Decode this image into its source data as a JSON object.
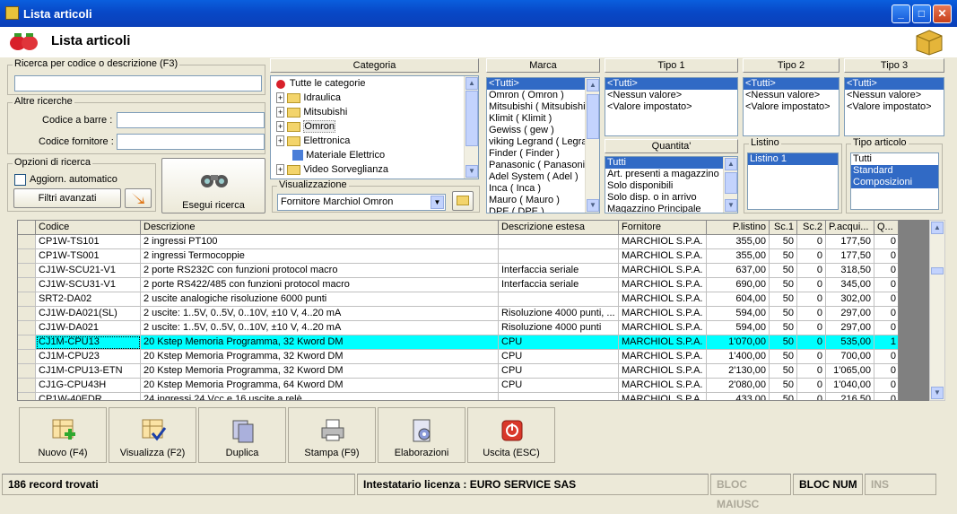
{
  "window": {
    "title": "Lista articoli"
  },
  "header": {
    "title": "Lista articoli"
  },
  "search": {
    "label": "Ricerca per codice o descrizione (F3)",
    "value": ""
  },
  "other": {
    "label": "Altre ricerche",
    "barcode_label": "Codice a barre :",
    "supplier_code_label": "Codice fornitore :"
  },
  "options": {
    "label": "Opzioni di ricerca",
    "auto_update": "Aggiorn. automatico",
    "advanced_filters": "Filtri avanzati",
    "run_search": "Esegui ricerca"
  },
  "category": {
    "header": "Categoria",
    "items": [
      "Tutte le categorie",
      "Idraulica",
      "Mitsubishi",
      "Omron",
      "Elettronica",
      "Materiale Elettrico",
      "Video Sorveglianza"
    ]
  },
  "view": {
    "label": "Visualizzazione",
    "value": "Fornitore Marchiol Omron"
  },
  "brand": {
    "header": "Marca",
    "items": [
      "<Tutti>",
      "Omron ( Omron )",
      "Mitsubishi ( Mitsubishi",
      "Klimit ( Klimit )",
      "Gewiss ( gew )",
      "viking Legrand ( Legra",
      "Finder ( Finder )",
      "Panasonic ( Panasonic",
      "Adel System ( Adel )",
      "Inca ( Inca )",
      "Mauro ( Mauro )",
      "DPE ( DPE )"
    ]
  },
  "tipo1": {
    "header": "Tipo 1",
    "items": [
      "<Tutti>",
      "<Nessun valore>",
      "<Valore impostato>"
    ]
  },
  "tipo2": {
    "header": "Tipo 2",
    "items": [
      "<Tutti>",
      "<Nessun valore>",
      "<Valore impostato>"
    ]
  },
  "tipo3": {
    "header": "Tipo 3",
    "items": [
      "<Tutti>",
      "<Nessun valore>",
      "<Valore impostato>"
    ]
  },
  "quantita": {
    "header": "Quantita'",
    "items": [
      "Tutti",
      "Art. presenti a magazzino",
      "Solo disponibili",
      "Solo disp. o in arrivo",
      "Magazzino Principale"
    ]
  },
  "listino": {
    "label": "Listino",
    "items": [
      "Listino 1"
    ]
  },
  "tipo_articolo": {
    "label": "Tipo articolo",
    "items": [
      "Tutti",
      "Standard",
      "Composizioni"
    ]
  },
  "table": {
    "columns": [
      "Codice",
      "Descrizione",
      "Descrizione estesa",
      "Fornitore",
      "P.listino",
      "Sc.1",
      "Sc.2",
      "P.acqui...",
      "Q..."
    ],
    "rows": [
      [
        "CP1W-TS101",
        "2 ingressi PT100",
        "",
        "MARCHIOL S.P.A.",
        "355,00",
        "50",
        "0",
        "177,50",
        "0"
      ],
      [
        "CP1W-TS001",
        "2 ingressi Termocoppie",
        "",
        "MARCHIOL S.P.A.",
        "355,00",
        "50",
        "0",
        "177,50",
        "0"
      ],
      [
        "CJ1W-SCU21-V1",
        "2 porte RS232C con funzioni protocol macro",
        "Interfaccia seriale",
        "MARCHIOL S.P.A.",
        "637,00",
        "50",
        "0",
        "318,50",
        "0"
      ],
      [
        "CJ1W-SCU31-V1",
        "2 porte RS422/485 con funzioni protocol macro",
        "Interfaccia seriale",
        "MARCHIOL S.P.A.",
        "690,00",
        "50",
        "0",
        "345,00",
        "0"
      ],
      [
        "SRT2-DA02",
        "2 uscite analogiche risoluzione 6000 punti",
        "",
        "MARCHIOL S.P.A.",
        "604,00",
        "50",
        "0",
        "302,00",
        "0"
      ],
      [
        "CJ1W-DA021(SL)",
        "2 uscite: 1..5V, 0..5V, 0..10V, ±10 V, 4..20 mA",
        "Risoluzione 4000 punti, ...",
        "MARCHIOL S.P.A.",
        "594,00",
        "50",
        "0",
        "297,00",
        "0"
      ],
      [
        "CJ1W-DA021",
        "2 uscite: 1..5V, 0..5V, 0..10V, ±10 V, 4..20 mA",
        "Risoluzione 4000 punti",
        "MARCHIOL S.P.A.",
        "594,00",
        "50",
        "0",
        "297,00",
        "0"
      ],
      [
        "CJ1M-CPU13",
        "20 Kstep Memoria Programma, 32 Kword DM",
        "CPU",
        "MARCHIOL S.P.A.",
        "1'070,00",
        "50",
        "0",
        "535,00",
        "1"
      ],
      [
        "CJ1M-CPU23",
        "20 Kstep Memoria Programma, 32 Kword DM",
        "CPU",
        "MARCHIOL S.P.A.",
        "1'400,00",
        "50",
        "0",
        "700,00",
        "0"
      ],
      [
        "CJ1M-CPU13-ETN",
        "20 Kstep Memoria Programma, 32 Kword DM",
        "CPU",
        "MARCHIOL S.P.A.",
        "2'130,00",
        "50",
        "0",
        "1'065,00",
        "0"
      ],
      [
        "CJ1G-CPU43H",
        "20 Kstep Memoria Programma, 64 Kword DM",
        "CPU",
        "MARCHIOL S.P.A.",
        "2'080,00",
        "50",
        "0",
        "1'040,00",
        "0"
      ],
      [
        "CP1W-40EDR",
        "24 ingressi 24 Vcc e 16 uscite a relè",
        "",
        "MARCHIOL S.P.A.",
        "433,00",
        "50",
        "0",
        "216,50",
        "0"
      ]
    ]
  },
  "toolbar": {
    "new": "Nuovo (F4)",
    "view": "Visualizza (F2)",
    "duplicate": "Duplica",
    "print": "Stampa (F9)",
    "process": "Elaborazioni",
    "exit": "Uscita (ESC)"
  },
  "status": {
    "records": "186 record trovati",
    "license": "Intestatario licenza : EURO SERVICE SAS",
    "caps": "BLOC MAIUSC",
    "num": "BLOC NUM",
    "ins": "INS"
  }
}
